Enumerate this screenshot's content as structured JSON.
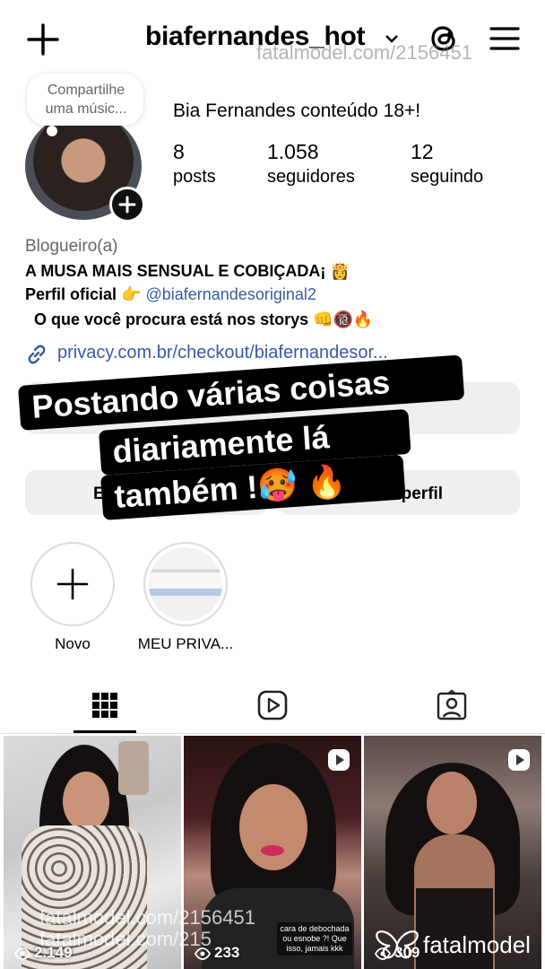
{
  "header": {
    "username": "biafernandes_hot",
    "watermark": "fatalmodel.com/2156451"
  },
  "profile": {
    "note": "Compartilhe uma músic...",
    "display_name": "Bia Fernandes conteúdo 18+!",
    "stats": [
      {
        "value": "8",
        "label": "posts"
      },
      {
        "value": "1.058",
        "label": "seguidores"
      },
      {
        "value": "12",
        "label": "seguindo"
      }
    ],
    "category": "Blogueiro(a)",
    "bio_line1": "A MUSA MAIS SENSUAL E COBIÇADA¡ 👸",
    "bio_line2_prefix": "Perfil oficial 👉",
    "bio_line2_mention": "@biafernandesoriginal2",
    "bio_line3": "O que  você procura está nos storys 👊🔞🔥",
    "link": "privacy.com.br/checkout/biafernandesor..."
  },
  "buttons": {
    "edit_label": "E",
    "share_label": "tilhar perfil"
  },
  "overlay": {
    "line1": "Postando várias coisas",
    "line2": "diariamente lá",
    "line3": "também !🥵  🔥"
  },
  "highlights": [
    {
      "label": "Novo"
    },
    {
      "label": "MEU PRIVA..."
    }
  ],
  "posts": [
    {
      "views": "2.149"
    },
    {
      "views": "233",
      "note": "cara de debochada ou esnobe ?! Que isso, jamais kkk"
    },
    {
      "views": "309"
    }
  ],
  "post_watermark": "fatalmodel.com/2156451",
  "post_watermark_partial": "fatalmodel.com/215",
  "brand_logo": "fatalmodel",
  "icons": [
    "plus-icon",
    "chevron-down-icon",
    "threads-icon",
    "menu-icon",
    "link-icon",
    "grid-icon",
    "reels-icon",
    "tagged-icon",
    "play-icon",
    "eye-icon"
  ]
}
